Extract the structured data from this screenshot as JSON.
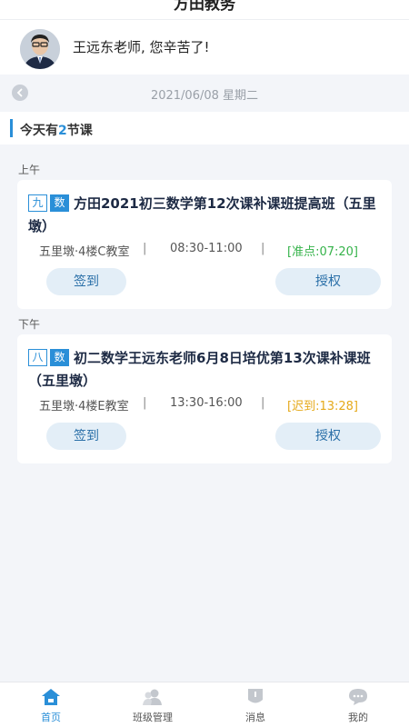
{
  "header": {
    "title": "方田教务"
  },
  "greeting": {
    "text": "王远东老师, 您辛苦了!"
  },
  "date_bar": {
    "date": "2021/06/08 星期二"
  },
  "summary": {
    "prefix": "今天有",
    "count": "2",
    "suffix": "节课"
  },
  "sections": {
    "morning": "上午",
    "afternoon": "下午"
  },
  "lessons": [
    {
      "grade": "九",
      "subject": "数",
      "title": "方田2021初三数学第12次课补课班提高班（五里墩）",
      "room": "五里墩·4楼C教室",
      "time": "08:30-11:00",
      "status": "[准点:07:20]",
      "status_color": "#35b34a",
      "sign_label": "签到",
      "auth_label": "授权"
    },
    {
      "grade": "八",
      "subject": "数",
      "title": "初二数学王远东老师6月8日培优第13次课补课班（五里墩）",
      "room": "五里墩·4楼E教室",
      "time": "13:30-16:00",
      "status": "[迟到:13:28]",
      "status_color": "#e5a91a",
      "sign_label": "签到",
      "auth_label": "授权"
    }
  ],
  "tabs": [
    {
      "label": "首页",
      "icon": "home-icon",
      "active": true
    },
    {
      "label": "班级管理",
      "icon": "class-manage-icon",
      "active": false
    },
    {
      "label": "消息",
      "icon": "message-icon",
      "active": false
    },
    {
      "label": "我的",
      "icon": "profile-chat-icon",
      "active": false
    }
  ],
  "colors": {
    "accent": "#2a8fd8",
    "on_time": "#35b34a",
    "late": "#e5a91a"
  }
}
